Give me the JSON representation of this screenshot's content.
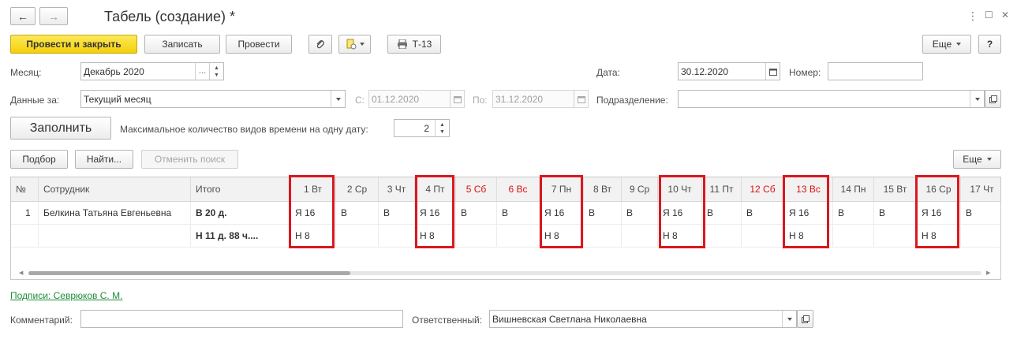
{
  "window": {
    "title": "Табель (создание) *",
    "back_label": "←",
    "forward_label": "→",
    "menu_label": "⋮",
    "maximize_label": "☐",
    "close_label": "✕"
  },
  "toolbar": {
    "post_close": "Провести и закрыть",
    "save": "Записать",
    "post": "Провести",
    "print_t13": "Т-13",
    "more": "Еще",
    "help": "?"
  },
  "form": {
    "month_label": "Месяц:",
    "month_value": "Декабрь 2020",
    "data_for_label": "Данные за:",
    "data_for_value": "Текущий месяц",
    "from_label": "С:",
    "from_value": "01.12.2020",
    "to_label": "По:",
    "to_value": "31.12.2020",
    "date_label": "Дата:",
    "date_value": "30.12.2020",
    "number_label": "Номер:",
    "number_value": "",
    "department_label": "Подразделение:",
    "department_value": "",
    "fill_button": "Заполнить",
    "max_types_label": "Максимальное количество видов времени на одну дату:",
    "max_types_value": "2"
  },
  "table_toolbar": {
    "select": "Подбор",
    "find": "Найти...",
    "cancel_search": "Отменить поиск",
    "more": "Еще"
  },
  "table": {
    "headers": {
      "num": "№",
      "employee": "Сотрудник",
      "total": "Итого",
      "days": [
        {
          "label": "1 Вт",
          "weekend": false
        },
        {
          "label": "2 Ср",
          "weekend": false
        },
        {
          "label": "3 Чт",
          "weekend": false
        },
        {
          "label": "4 Пт",
          "weekend": false
        },
        {
          "label": "5 Сб",
          "weekend": true
        },
        {
          "label": "6 Вс",
          "weekend": true
        },
        {
          "label": "7 Пн",
          "weekend": false
        },
        {
          "label": "8 Вт",
          "weekend": false
        },
        {
          "label": "9 Ср",
          "weekend": false
        },
        {
          "label": "10 Чт",
          "weekend": false
        },
        {
          "label": "11 Пт",
          "weekend": false
        },
        {
          "label": "12 Сб",
          "weekend": true
        },
        {
          "label": "13 Вс",
          "weekend": true
        },
        {
          "label": "14 Пн",
          "weekend": false
        },
        {
          "label": "15 Вт",
          "weekend": false
        },
        {
          "label": "16 Ср",
          "weekend": false
        },
        {
          "label": "17 Чт",
          "weekend": false
        }
      ]
    },
    "rows": [
      {
        "num": "1",
        "employee": "Белкина Татьяна Евгеньевна",
        "total_line1": "В 20 д.",
        "total_line2": "Н 11 д. 88 ч....",
        "line1": [
          "Я 16",
          "В",
          "В",
          "Я 16",
          "В",
          "В",
          "Я 16",
          "В",
          "В",
          "Я 16",
          "В",
          "В",
          "Я 16",
          "В",
          "В",
          "Я 16",
          "В"
        ],
        "line2": [
          "Н 8",
          "",
          "",
          "Н 8",
          "",
          "",
          "Н 8",
          "",
          "",
          "Н 8",
          "",
          "",
          "Н 8",
          "",
          "",
          "Н 8",
          ""
        ]
      }
    ]
  },
  "footer": {
    "signatures_link": "Подписи: Севрюков С. М.",
    "comment_label": "Комментарий:",
    "comment_value": "",
    "responsible_label": "Ответственный:",
    "responsible_value": "Вишневская Светлана Николаевна"
  },
  "colors": {
    "highlight": "#d9181f",
    "weekend": "#dd1111",
    "primary_button": "#f4cf09",
    "link": "#1d8e3a"
  }
}
